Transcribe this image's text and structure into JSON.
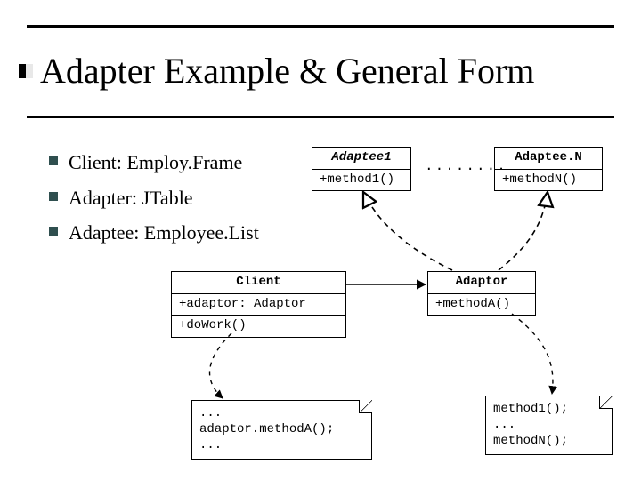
{
  "title": "Adapter Example & General Form",
  "bullets": [
    "Client: Employ.Frame",
    "Adapter: JTable",
    "Adaptee: Employee.List"
  ],
  "uml": {
    "adaptee1": {
      "name": "Adaptee1",
      "method": "+method1()"
    },
    "adapteeN": {
      "name": "Adaptee.N",
      "method": "+methodN()"
    },
    "client": {
      "name": "Client",
      "attr": "+adaptor: Adaptor",
      "op": "+doWork()"
    },
    "adaptor": {
      "name": "Adaptor",
      "method": "+methodA()"
    },
    "clientNote": "...\nadaptor.methodA();\n...",
    "adaptorNote": "method1();\n...\nmethodN();",
    "dots_label": "........"
  }
}
